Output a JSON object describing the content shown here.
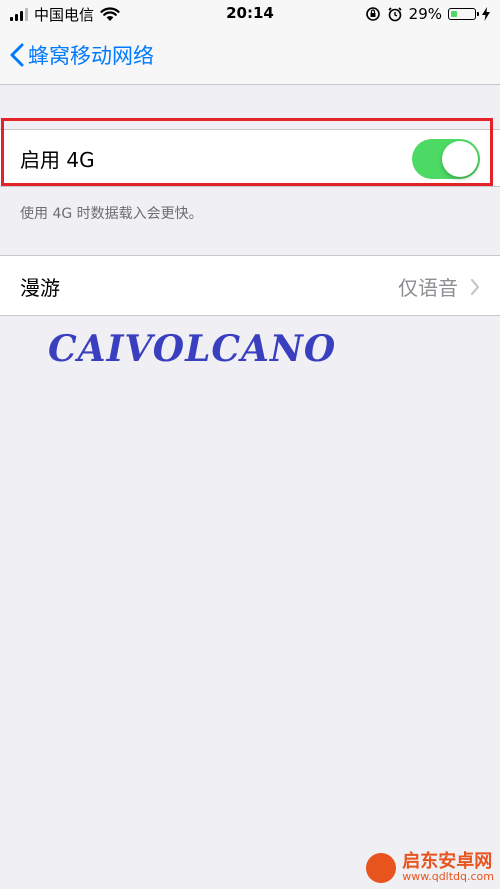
{
  "status_bar": {
    "carrier": "中国电信",
    "time": "20:14",
    "battery_percent": "29%",
    "battery_level": 0.29
  },
  "nav": {
    "back_title": "蜂窝移动网络"
  },
  "enable_4g": {
    "label": "启用 4G",
    "toggle_on": true,
    "footnote": "使用 4G 时数据载入会更快。"
  },
  "roaming": {
    "label": "漫游",
    "value": "仅语音"
  },
  "watermark": "CAIVOLCANO",
  "corner_logo": {
    "name": "启东安卓网",
    "url": "www.qdltdq.com"
  },
  "colors": {
    "ios_blue": "#007aff",
    "toggle_green": "#4cd964",
    "highlight_red": "#e0242a",
    "background": "#efeff4"
  }
}
